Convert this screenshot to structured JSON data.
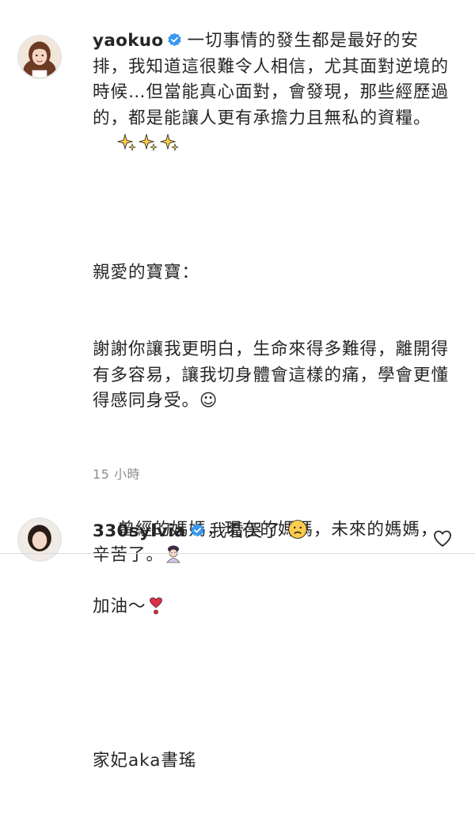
{
  "main_comment": {
    "username": "yaokuo",
    "line1": "一切事情的發生都是最好的安排，我知道這很難令人相信，尤其面對逆境的時候…但當能真心面對，會發現，那些經歷過的，都是能讓人更有承擔力且無私的資糧。",
    "line2": "親愛的寶寶：",
    "line3": "謝謝你讓我更明白，生命來得多難得，離開得有多容易，讓我切身體會這樣的痛，學會更懂得感同身受。☺",
    "line4": "曾經的媽媽，現在的媽媽，未來的媽媽，辛苦了。",
    "line5": "加油～",
    "line6": "家妃aka書瑤",
    "timestamp": "15 小時"
  },
  "reply_comment": {
    "username": "330sylvia",
    "text": "我看哭了"
  },
  "icons": {
    "verified": "verified-badge-icon",
    "sparkles": "sparkles-emoji",
    "woman": "woman-emoji",
    "heart_exclamation": "heart-exclamation-emoji",
    "sad_face": "sad-face-emoji",
    "like": "heart-outline-icon"
  },
  "colors": {
    "text": "#262626",
    "muted": "#8e8e8e",
    "verified": "#3897f0",
    "heart": "#dd2e44",
    "sparkle": "#ffcc4d"
  }
}
